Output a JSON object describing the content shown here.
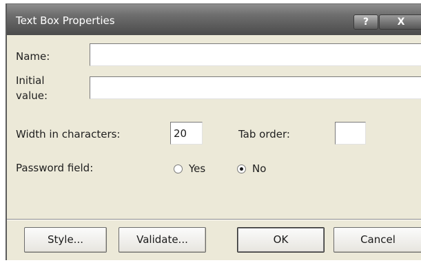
{
  "window": {
    "title": "Text Box Properties",
    "help_label": "?",
    "close_label": "X"
  },
  "form": {
    "name_label": "Name:",
    "name_value": "",
    "initial_label_line1": "Initial",
    "initial_label_line2": "value:",
    "initial_value": "",
    "width_label": "Width in characters:",
    "width_value": "20",
    "tab_order_label": "Tab order:",
    "tab_order_value": "",
    "password_label": "Password field:",
    "password_options": [
      {
        "label": "Yes",
        "selected": false
      },
      {
        "label": "No",
        "selected": true
      }
    ]
  },
  "buttons": {
    "style": "Style...",
    "validate": "Validate...",
    "ok": "OK",
    "cancel": "Cancel"
  }
}
